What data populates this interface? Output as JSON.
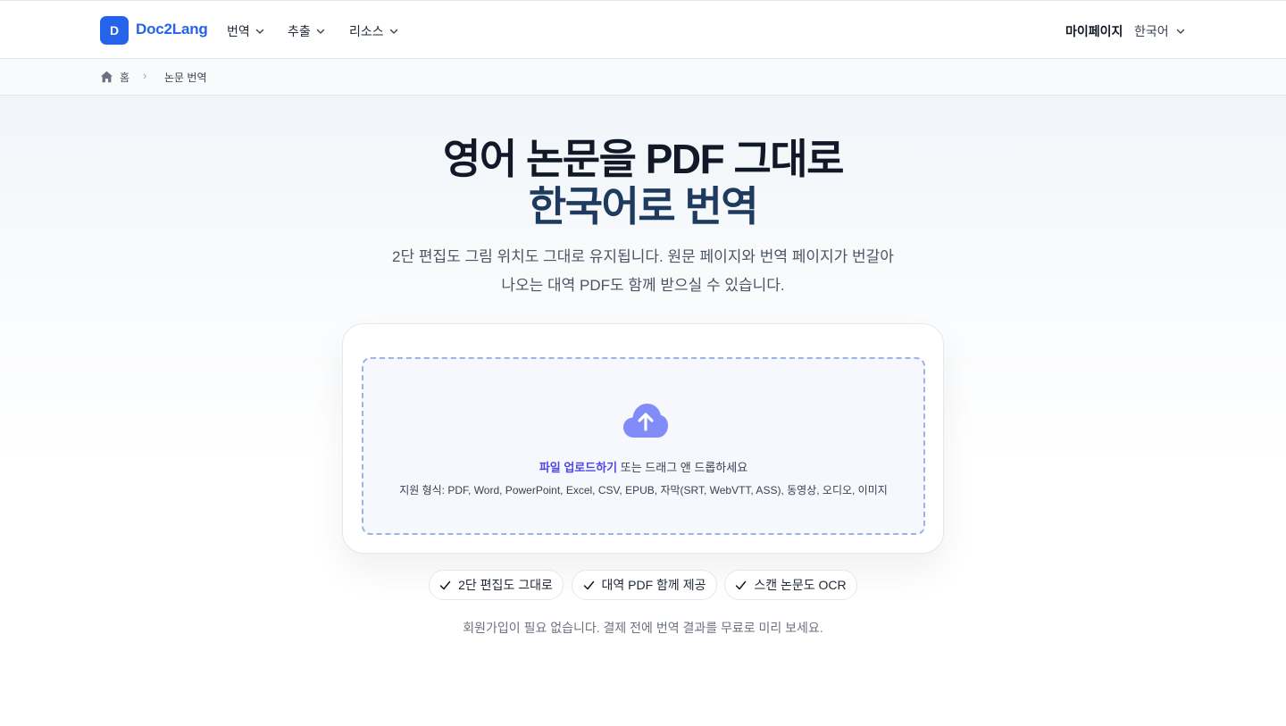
{
  "brand": {
    "logo_letter": "D",
    "name": "Doc2Lang",
    "color": "#2563eb"
  },
  "nav": {
    "items": [
      {
        "label": "번역"
      },
      {
        "label": "추출"
      },
      {
        "label": "리소스"
      }
    ],
    "mypage": "마이페이지",
    "language": "한국어"
  },
  "breadcrumb": {
    "home": "홈",
    "separator": "›",
    "current": "논문 번역"
  },
  "hero": {
    "title_line1": "영어 논문을 PDF 그대로",
    "title_line2": "한국어로 번역",
    "subtitle_line1": "2단 편집도 그림 위치도 그대로 유지됩니다. 원문 페이지와 번역 페이지가 번갈아",
    "subtitle_line2": "나오는 대역 PDF도 함께 받으실 수 있습니다."
  },
  "upload": {
    "link_label": "파일 업로드하기",
    "drag_text": " 또는 드래그 앤 드롭하세요",
    "formats": "지원 형식: PDF, Word, PowerPoint, Excel, CSV, EPUB, 자막(SRT, WebVTT, ASS), 동영상, 오디오, 이미지",
    "icon": "cloud-upload-icon",
    "icon_color": "#818cf8"
  },
  "features": [
    {
      "label": "2단 편집도 그대로"
    },
    {
      "label": "대역 PDF 함께 제공"
    },
    {
      "label": "스캔 논문도 OCR"
    }
  ],
  "note": "회원가입이 필요 없습니다. 결제 전에 번역 결과를 무료로 미리 보세요."
}
